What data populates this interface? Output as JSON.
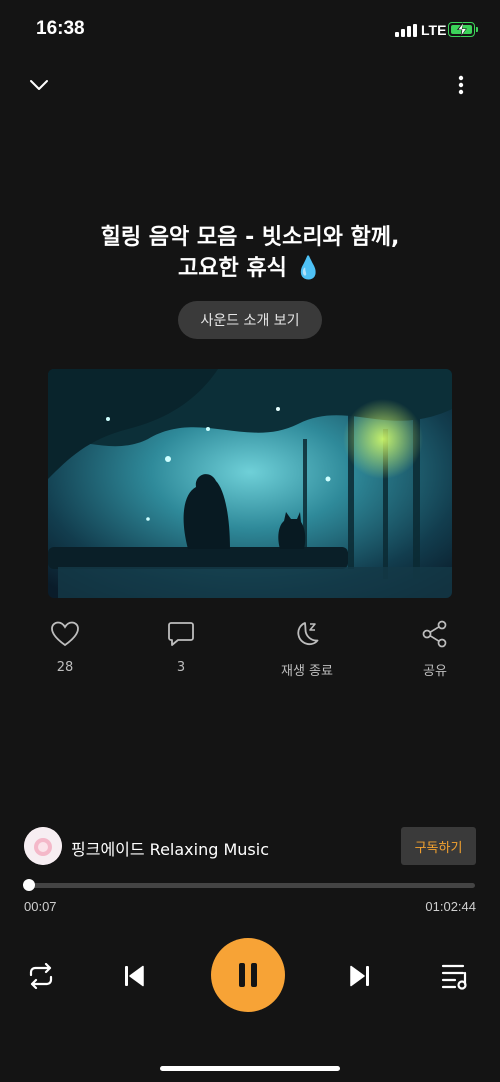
{
  "status_bar": {
    "time": "16:38",
    "network": "LTE"
  },
  "player": {
    "title_line1": "힐링 음악 모음 - 빗소리와 함께,",
    "title_line2": "고요한 휴식 💧",
    "intro_button": "사운드 소개 보기"
  },
  "actions": {
    "like_count": "28",
    "comment_count": "3",
    "sleep_timer_label": "재생 종료",
    "share_label": "공유"
  },
  "channel": {
    "name": "핑크에이드 Relaxing Music",
    "subscribe_label": "구독하기"
  },
  "playback": {
    "current_time": "00:07",
    "total_time": "01:02:44",
    "progress_fraction": 0.002
  },
  "icons": [
    "chevron-down-icon",
    "more-vertical-icon",
    "heart-icon",
    "comment-icon",
    "moon-sleep-icon",
    "share-icon",
    "repeat-icon",
    "previous-icon",
    "pause-icon",
    "next-icon",
    "playlist-icon"
  ],
  "colors": {
    "accent": "#f7a336",
    "background": "#141414",
    "battery": "#3cd35a"
  }
}
